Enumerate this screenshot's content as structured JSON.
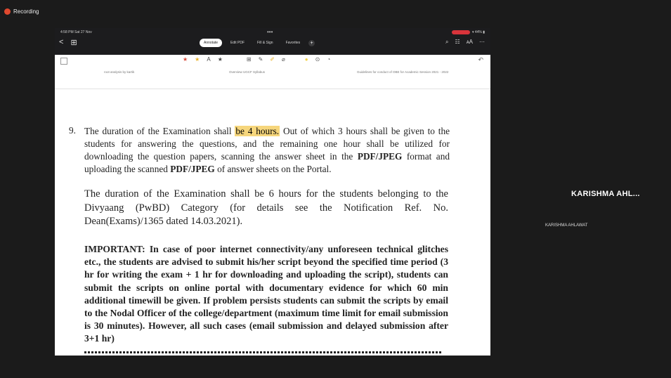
{
  "recording": {
    "label": "Recording"
  },
  "ipad": {
    "status_time": "4:58 PM  Sat 27 Nov",
    "dots": "•••",
    "battery": "▾ 44% ▮",
    "nav": {
      "back": "<",
      "grid": "⊞"
    },
    "tabs": [
      {
        "label": "Annotate",
        "active": true
      },
      {
        "label": "Edit PDF",
        "active": false
      },
      {
        "label": "Fill & Sign",
        "active": false
      },
      {
        "label": "Favorites",
        "active": false
      }
    ],
    "tab_plus": "+",
    "right_tools": [
      "⌕",
      "☷",
      "ᴀA",
      "⋯"
    ],
    "undo": "↶",
    "doc_tabs": [
      "root analysis by kartik",
      "Overview UGCF Syllabus",
      "Guidelines for conduct of OBE for Academic Session 2021 - 2022"
    ]
  },
  "document": {
    "item_number": "9.",
    "p1": {
      "before": "The duration of the Examination shall ",
      "highlight": "be 4 hours.",
      "after": " Out of which 3 hours shall be given to the students for answering the questions, and the remaining one hour shall be utilized for downloading the question papers, scanning the answer sheet in the ",
      "bold1": "PDF/JPEG",
      "mid": " format and uploading the scanned ",
      "bold2": "PDF/JPEG",
      "end": " of answer sheets on the Portal."
    },
    "p2": "The duration of the Examination shall be 6 hours for the students belonging to the Divyaang (PwBD) Category (for details see the Notification Ref. No. Dean(Exams)/1365 dated 14.03.2021).",
    "p3": "IMPORTANT: In case of poor internet connectivity/any unforeseen technical glitches etc., the students are advised to submit his/her script beyond the specified time period (3 hr for writing the exam + 1 hr for downloading and uploading the script), students can submit the scripts on online portal with documentary evidence for which 60 min additional timewill be given. If problem persists students can submit the scripts by email to the Nodal Officer of the college/department (maximum time limit for email submission is 30 minutes). However, all such cases (email submission and delayed submission after 3+1 hr)"
  },
  "participant": {
    "name_large": "KARISHMA  AHL...",
    "name_small": "KARISHMA AHLAWAT"
  },
  "colors": {
    "highlight": "#f6d67c",
    "record": "#e0492f",
    "background": "#1b1b1b"
  }
}
